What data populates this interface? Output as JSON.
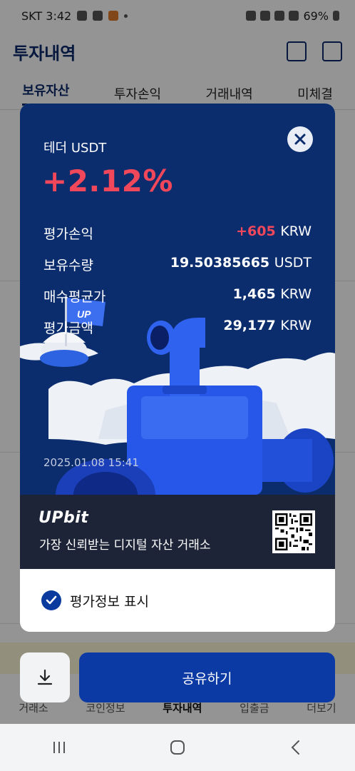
{
  "status_bar": {
    "carrier_time": "SKT 3:42",
    "battery": "69%"
  },
  "app": {
    "title": "투자내역",
    "tabs": [
      {
        "label": "보유자산",
        "active": true
      },
      {
        "label": "투자손익",
        "active": false
      },
      {
        "label": "거래내역",
        "active": false
      },
      {
        "label": "미체결",
        "active": false
      }
    ],
    "bottom_nav": [
      {
        "label": "거래소",
        "active": false
      },
      {
        "label": "코인정보",
        "active": false
      },
      {
        "label": "투자내역",
        "active": true
      },
      {
        "label": "입출금",
        "active": false
      },
      {
        "label": "더보기",
        "active": false
      }
    ]
  },
  "share_card": {
    "asset_name": "테더 USDT",
    "return_rate": "+2.12%",
    "stats": [
      {
        "label": "평가손익",
        "value": "+605",
        "unit": "KRW",
        "positive": true
      },
      {
        "label": "보유수량",
        "value": "19.50385665",
        "unit": "USDT",
        "positive": false
      },
      {
        "label": "매수평균가",
        "value": "1,465",
        "unit": "KRW",
        "positive": false
      },
      {
        "label": "평가금액",
        "value": "29,177",
        "unit": "KRW",
        "positive": false
      }
    ],
    "date": "2025.01.08 15:41",
    "logo": "UPbit",
    "slogan": "가장 신뢰받는 디지털 자산 거래소",
    "show_eval_label": "평가정보 표시",
    "show_eval_checked": true,
    "flag_text": "UP"
  },
  "actions": {
    "share_label": "공유하기"
  },
  "colors": {
    "card_bg": "#0b2d6e",
    "positive": "#f0475a",
    "brand_bar": "#1d2438",
    "primary_button": "#0b3aa4",
    "app_title": "#0b2a6b"
  },
  "icons": [
    "close-icon",
    "download-icon",
    "share-icon",
    "chat-icon",
    "check-icon",
    "qr-code",
    "recent-apps-icon",
    "home-icon",
    "back-icon"
  ]
}
